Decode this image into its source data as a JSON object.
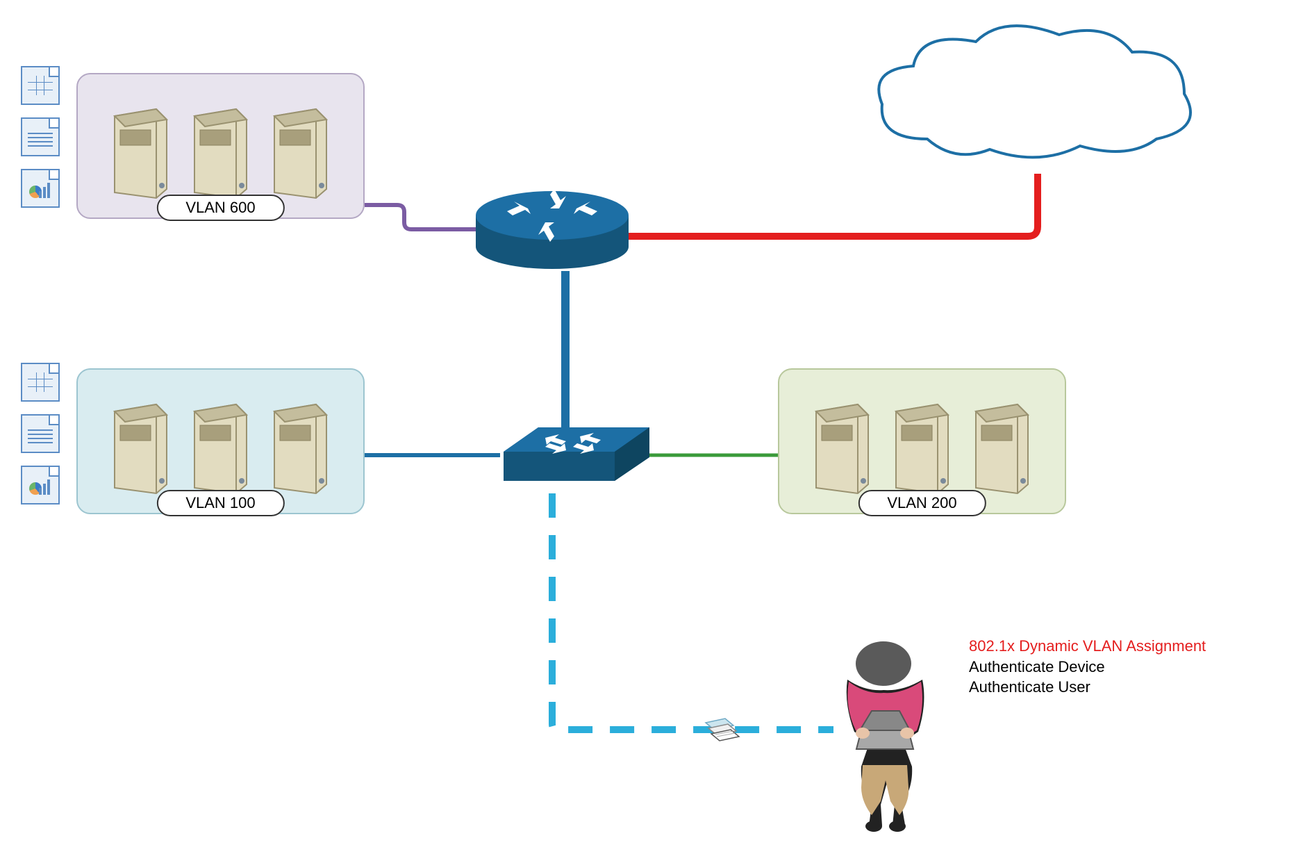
{
  "vlans": {
    "vlan600": {
      "label": "VLAN 600"
    },
    "vlan100": {
      "label": "VLAN 100"
    },
    "vlan200": {
      "label": "VLAN 200"
    }
  },
  "annotation": {
    "title": "802.1x Dynamic VLAN Assignment",
    "line1": "Authenticate Device",
    "line2": "Authenticate User"
  },
  "colors": {
    "linkPurple": "#7b5ca3",
    "linkRed": "#e41e1e",
    "linkBlue": "#1d6fa5",
    "linkGreen": "#3a9a3a",
    "linkCyan": "#2baedb",
    "ciscoBlue": "#1d6fa5",
    "serverBody": "#e2dcc0",
    "serverShade": "#c4bd9d",
    "serverDark": "#a89f7c"
  },
  "nodes": {
    "router": "router",
    "switch": "switch",
    "cloud": "cloud",
    "user": "person-with-laptop"
  }
}
